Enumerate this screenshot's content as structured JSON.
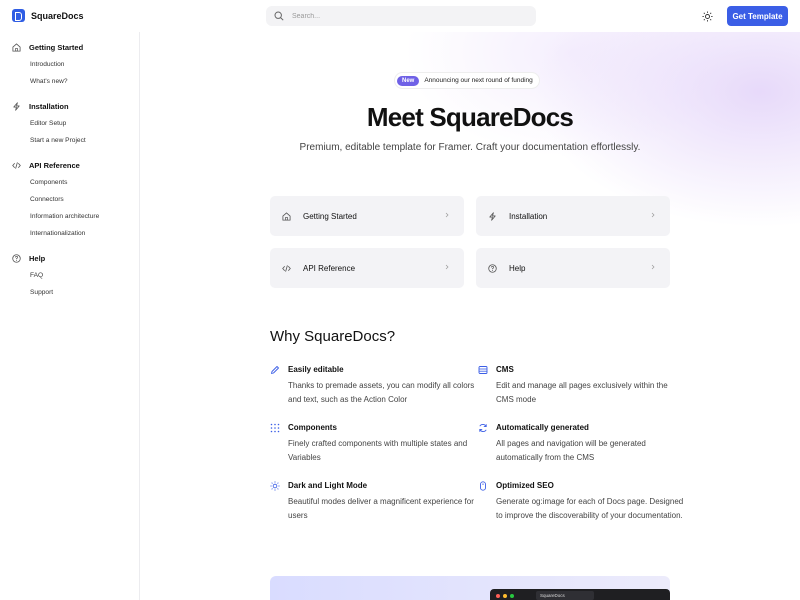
{
  "header": {
    "brand": "SquareDocs",
    "search_placeholder": "Search...",
    "cta_label": "Get Template"
  },
  "sidebar": {
    "sections": [
      {
        "title": "Getting Started",
        "icon": "home-icon",
        "links": [
          "Introduction",
          "What's new?"
        ]
      },
      {
        "title": "Installation",
        "icon": "lightning-icon",
        "links": [
          "Editor Setup",
          "Start a new Project"
        ]
      },
      {
        "title": "API Reference",
        "icon": "code-icon",
        "links": [
          "Components",
          "Connectors",
          "Information architecture",
          "Internationalization"
        ]
      },
      {
        "title": "Help",
        "icon": "help-circle-icon",
        "links": [
          "FAQ",
          "Support"
        ]
      }
    ]
  },
  "hero": {
    "badge": "New",
    "announcement": "Announcing our next round of funding",
    "title": "Meet SquareDocs",
    "subtitle": "Premium, editable template for Framer. Craft your documentation effortlessly."
  },
  "cards": [
    {
      "label": "Getting Started",
      "icon": "home-icon"
    },
    {
      "label": "Installation",
      "icon": "lightning-icon"
    },
    {
      "label": "API Reference",
      "icon": "code-icon"
    },
    {
      "label": "Help",
      "icon": "help-circle-icon"
    }
  ],
  "why": {
    "title": "Why SquareDocs?",
    "features": [
      {
        "title": "Easily editable",
        "desc": "Thanks to premade assets, you can modify all colors and text, such as the Action Color",
        "icon": "pencil-icon"
      },
      {
        "title": "CMS",
        "desc": "Edit and manage all pages exclusively within the CMS mode",
        "icon": "database-icon"
      },
      {
        "title": "Components",
        "desc": "Finely crafted components with multiple states and Variables",
        "icon": "grid-icon"
      },
      {
        "title": "Automatically generated",
        "desc": "All pages and navigation will be generated automatically from the CMS",
        "icon": "refresh-icon"
      },
      {
        "title": "Dark and Light Mode",
        "desc": "Beautiful modes deliver a magnificent experience for users",
        "icon": "sun-icon"
      },
      {
        "title": "Optimized SEO",
        "desc": "Generate og:image for each of Docs page. Designed to improve the discoverability of your documentation.",
        "icon": "seo-icon"
      }
    ]
  },
  "preview": {
    "tab_label": "SquareDocs"
  },
  "colors": {
    "accent": "#3b5ee6",
    "badge": "#6f61e6",
    "icon_blue": "#3b5ee6"
  }
}
